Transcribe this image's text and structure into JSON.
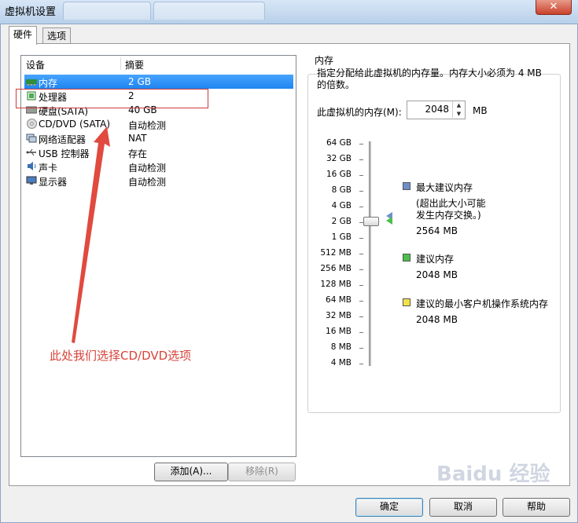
{
  "window": {
    "title": "虚拟机设置",
    "close_glyph": "✕"
  },
  "tabs": [
    {
      "label": "硬件",
      "active": true
    },
    {
      "label": "选项",
      "active": false
    }
  ],
  "device_list": {
    "headers": {
      "device": "设备",
      "summary": "摘要"
    },
    "rows": [
      {
        "name": "内存",
        "summary": "2 GB",
        "icon": "memory-icon",
        "selected": true
      },
      {
        "name": "处理器",
        "summary": "2",
        "icon": "processor-icon",
        "selected": false
      },
      {
        "name": "硬盘(SATA)",
        "summary": "40 GB",
        "icon": "hard-disk-icon",
        "selected": false
      },
      {
        "name": "CD/DVD (SATA)",
        "summary": "自动检测",
        "icon": "cd-dvd-icon",
        "selected": false
      },
      {
        "name": "网络适配器",
        "summary": "NAT",
        "icon": "network-adapter-icon",
        "selected": false
      },
      {
        "name": "USB 控制器",
        "summary": "存在",
        "icon": "usb-icon",
        "selected": false
      },
      {
        "name": "声卡",
        "summary": "自动检测",
        "icon": "sound-card-icon",
        "selected": false
      },
      {
        "name": "显示器",
        "summary": "自动检测",
        "icon": "display-icon",
        "selected": false
      }
    ]
  },
  "annotation": {
    "text": "此处我们选择CD/DVD选项",
    "color": "#d9433a"
  },
  "list_buttons": {
    "add": "添加(A)...",
    "remove": "移除(R)"
  },
  "memory_panel": {
    "group_title": "内存",
    "description": "指定分配给此虚拟机的内存量。内存大小必须为 4 MB 的倍数。",
    "memory_label": "此虚拟机的内存(M):",
    "memory_value": "2048",
    "memory_unit": "MB",
    "scale": [
      "64 GB",
      "32 GB",
      "16 GB",
      "8 GB",
      "4 GB",
      "2 GB",
      "1 GB",
      "512 MB",
      "256 MB",
      "128 MB",
      "64 MB",
      "32 MB",
      "16 MB",
      "8 MB",
      "4 MB"
    ],
    "slider_value": "2 GB",
    "legend": {
      "max_recommended": {
        "title": "最大建议内存",
        "note_line1": "(超出此大小可能",
        "note_line2": "发生内存交换。)",
        "value": "2564 MB",
        "color": "#6f8fc9"
      },
      "recommended": {
        "title": "建议内存",
        "value": "2048 MB",
        "color": "#4cbf4c"
      },
      "guest_min": {
        "title": "建议的最小客户机操作系统内存",
        "value": "2048 MB",
        "color": "#f2e24a"
      }
    }
  },
  "footer_buttons": {
    "ok": "确定",
    "cancel": "取消",
    "help": "帮助"
  },
  "watermark": "Baidu 经验"
}
